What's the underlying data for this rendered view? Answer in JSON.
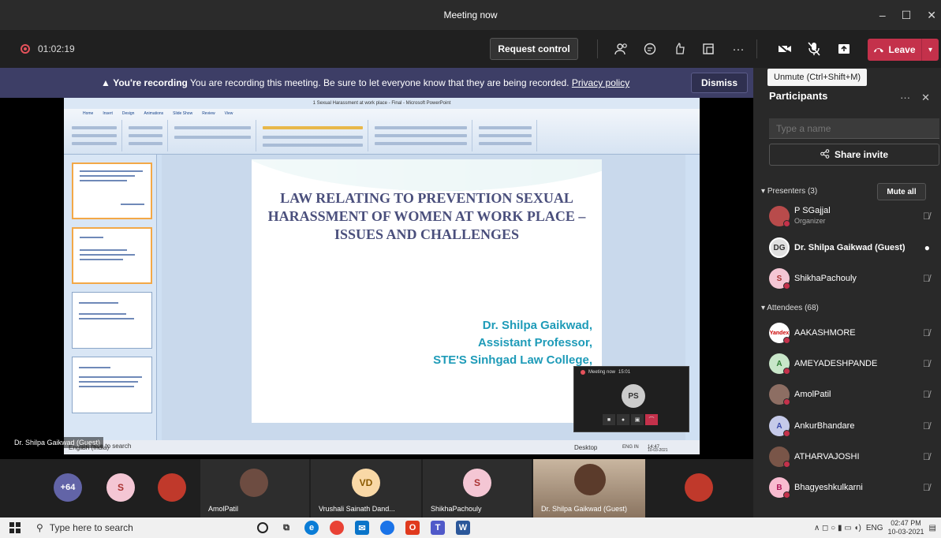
{
  "window": {
    "title": "Meeting now",
    "min_label": "–",
    "max_label": "☐",
    "close_label": "✕"
  },
  "toolbar": {
    "timer": "01:02:19",
    "request_control": "Request control",
    "more_label": "···",
    "leave": "Leave"
  },
  "banner": {
    "warning_icon": "▲",
    "bold": "You're recording",
    "message": " You are recording this meeting. Be sure to let everyone know that they are being recorded. ",
    "link": "Privacy policy",
    "dismiss": "Dismiss"
  },
  "tooltip": "Unmute (Ctrl+Shift+M)",
  "ppt": {
    "window_title": "1 Sexual Harassment at work place - Final - Microsoft PowerPoint",
    "tabs": [
      "Home",
      "Insert",
      "Design",
      "Animations",
      "Slide Show",
      "Review",
      "View"
    ],
    "slide_heading": "LAW RELATING TO PREVENTION SEXUAL HARASSMENT OF WOMEN AT WORK PLACE – ISSUES AND CHALLENGES",
    "presenter_lines": [
      "Dr. Shilpa Gaikwad,",
      "Assistant Professor,",
      "STE'S Sinhgad Law College,",
      "Pu"
    ],
    "inner_search": "pe here to search",
    "inner_tray": "Desktop",
    "inner_lang": "ENG IN",
    "inner_time": "14:47",
    "inner_date": "10-03-2021",
    "status": "English (India)"
  },
  "mini_call": {
    "title": "Meeting now",
    "time": "15:01",
    "initials": "PS",
    "end_icon": "⌒"
  },
  "screen_owner": "Dr. Shilpa Gaikwad (Guest)",
  "participants": {
    "title": "Participants",
    "search_placeholder": "Type a name",
    "share_invite": "Share invite",
    "presenters_header": "Presenters (3)",
    "mute_all": "Mute all",
    "attendees_header": "Attendees (68)",
    "presenters": [
      {
        "name": "P SGajjal",
        "role": "Organizer",
        "initials": "",
        "color": "#b84b4b"
      },
      {
        "name": "Dr. Shilpa Gaikwad (Guest)",
        "role": "",
        "initials": "DG",
        "color": "#e0e0e0"
      },
      {
        "name": "ShikhaPachouly",
        "role": "",
        "initials": "S",
        "color": "#f4c6d4"
      }
    ],
    "attendees": [
      {
        "name": "AAKASHMORE",
        "initials": "Yandex",
        "color": "#ffffff"
      },
      {
        "name": "AMEYADESHPANDE",
        "initials": "A",
        "color": "#c8e6c9"
      },
      {
        "name": "AmolPatil",
        "initials": "",
        "color": "#8d6e63"
      },
      {
        "name": "AnkurBhandare",
        "initials": "A",
        "color": "#c5cae9"
      },
      {
        "name": "ATHARVAJOSHI",
        "initials": "",
        "color": "#795548"
      },
      {
        "name": "Bhagyeshkulkarni",
        "initials": "B",
        "color": "#f8bbd0"
      }
    ]
  },
  "gallery": {
    "more_count": "+64",
    "tiles": [
      {
        "label": "AmolPatil",
        "initials": ""
      },
      {
        "label": "Vrushali Sainath Dand...",
        "initials": "VD"
      },
      {
        "label": "ShikhaPachouly",
        "initials": "S"
      },
      {
        "label": "Dr. Shilpa Gaikwad (Guest)",
        "initials": ""
      }
    ],
    "s_initial": "S"
  },
  "taskbar": {
    "search": "Type here to search",
    "lang": "ENG",
    "time": "02:47 PM",
    "date": "10-03-2021"
  }
}
